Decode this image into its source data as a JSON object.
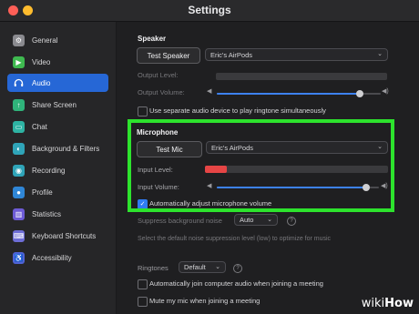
{
  "window": {
    "title": "Settings"
  },
  "sidebar": {
    "items": [
      {
        "label": "General",
        "icon": "gear-icon",
        "color": "#8a8a8f"
      },
      {
        "label": "Video",
        "icon": "video-icon",
        "color": "#3fb950"
      },
      {
        "label": "Audio",
        "icon": "headphones-icon",
        "color": "#2667d6",
        "active": true
      },
      {
        "label": "Share Screen",
        "icon": "share-screen-icon",
        "color": "#2fb37a"
      },
      {
        "label": "Chat",
        "icon": "chat-icon",
        "color": "#2eb3a3"
      },
      {
        "label": "Background & Filters",
        "icon": "background-icon",
        "color": "#2fa4b8"
      },
      {
        "label": "Recording",
        "icon": "recording-icon",
        "color": "#2fa4b8"
      },
      {
        "label": "Profile",
        "icon": "profile-icon",
        "color": "#2f86d6"
      },
      {
        "label": "Statistics",
        "icon": "statistics-icon",
        "color": "#6d5bd6"
      },
      {
        "label": "Keyboard Shortcuts",
        "icon": "keyboard-icon",
        "color": "#6d6dd6"
      },
      {
        "label": "Accessibility",
        "icon": "accessibility-icon",
        "color": "#4f63d6"
      }
    ]
  },
  "speaker": {
    "section_title": "Speaker",
    "test_button": "Test Speaker",
    "device": "Eric's AirPods",
    "output_level_label": "Output Level:",
    "output_volume_label": "Output Volume:",
    "output_volume_level": 0.87,
    "separate_device_label": "Use separate audio device to play ringtone simultaneously",
    "separate_device_checked": false
  },
  "microphone": {
    "section_title": "Microphone",
    "test_button": "Test Mic",
    "device": "Eric's AirPods",
    "input_level_label": "Input Level:",
    "input_level": 0.12,
    "input_volume_label": "Input Volume:",
    "input_volume_level": 0.92,
    "auto_adjust_label": "Automatically adjust microphone volume",
    "auto_adjust_checked": true
  },
  "noise": {
    "label": "Suppress background noise",
    "value": "Auto",
    "help_text": "Select the default noise suppression level (low) to optimize for music"
  },
  "ringtones": {
    "label": "Ringtones",
    "value": "Default"
  },
  "options": {
    "auto_join_label": "Automatically join computer audio when joining a meeting",
    "mute_label": "Mute my mic when joining a meeting"
  },
  "watermark": {
    "wiki": "wiki",
    "how": "How"
  },
  "colors": {
    "highlight": "#2de32d",
    "accent": "#2667d6",
    "level": "#e64545"
  }
}
